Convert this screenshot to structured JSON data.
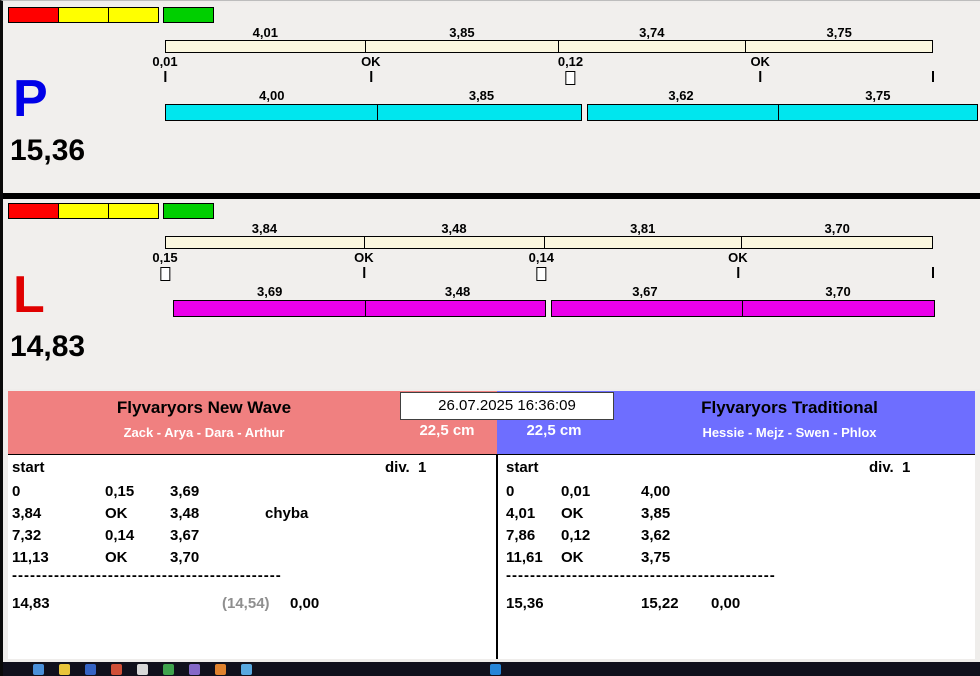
{
  "window": {
    "bg_color": "#f1efed",
    "divider_color": "#000000"
  },
  "lanes": [
    {
      "letter": "P",
      "letter_color": "#0000e8",
      "total": "15,36",
      "lights": [
        "#ff0000",
        "#ffff00",
        "#ffff00",
        "#00cf00"
      ],
      "split_bar": {
        "color": "#fbf7df",
        "segments": [
          {
            "label": "4,01",
            "value": 4.01
          },
          {
            "label": "3,85",
            "value": 3.85
          },
          {
            "label": "3,74",
            "value": 3.74
          },
          {
            "label": "3,75",
            "value": 3.75
          }
        ]
      },
      "markers": [
        {
          "label": "0,01",
          "symbol": "tick",
          "pos": 0
        },
        {
          "label": "OK",
          "symbol": "tick",
          "pos": 26.8
        },
        {
          "label": "0,12",
          "symbol": "box",
          "pos": 52.8
        },
        {
          "label": "OK",
          "symbol": "tick",
          "pos": 77.5
        }
      ],
      "time_bar": {
        "color": "#00e6ee",
        "segments": [
          {
            "label": "4,00",
            "value": 4.0
          },
          {
            "label": "3,85",
            "value": 3.85
          },
          {
            "label": "3,62",
            "value": 3.62
          },
          {
            "label": "3,75",
            "value": 3.75
          }
        ]
      }
    },
    {
      "letter": "L",
      "letter_color": "#e00000",
      "total": "14,83",
      "lights": [
        "#ff0000",
        "#ffff00",
        "#ffff00",
        "#00cf00"
      ],
      "split_bar": {
        "color": "#fbf7df",
        "segments": [
          {
            "label": "3,84",
            "value": 3.84
          },
          {
            "label": "3,48",
            "value": 3.48
          },
          {
            "label": "3,81",
            "value": 3.81
          },
          {
            "label": "3,70",
            "value": 3.7
          }
        ]
      },
      "markers": [
        {
          "label": "0,15",
          "symbol": "box",
          "pos": 0
        },
        {
          "label": "OK",
          "symbol": "tick",
          "pos": 25.9
        },
        {
          "label": "0,14",
          "symbol": "box",
          "pos": 49.0
        },
        {
          "label": "OK",
          "symbol": "tick",
          "pos": 74.6
        }
      ],
      "time_bar": {
        "color": "#ea00ea",
        "segments": [
          {
            "label": "3,69",
            "value": 3.69
          },
          {
            "label": "3,48",
            "value": 3.48
          },
          {
            "label": "3,67",
            "value": 3.67
          },
          {
            "label": "3,70",
            "value": 3.7
          }
        ]
      }
    }
  ],
  "scoreboard": {
    "datetime": "26.07.2025 16:36:09",
    "teams": [
      {
        "name": "Flyvaryors New Wave",
        "dogs": "Zack - Arya - Dara - Arthur",
        "jump_height": "22,5 cm",
        "header_color": "#f08080",
        "start_label": "start",
        "division_label": "div.  1",
        "rows": [
          {
            "cum": "0",
            "judge": "0,15",
            "split": "3,69",
            "note": ""
          },
          {
            "cum": "3,84",
            "judge": "OK",
            "split": "3,48",
            "note": "chyba"
          },
          {
            "cum": "7,32",
            "judge": "0,14",
            "split": "3,67",
            "note": ""
          },
          {
            "cum": "11,13",
            "judge": "OK",
            "split": "3,70",
            "note": ""
          }
        ],
        "separator": "---------------------------------------------",
        "total": "14,83",
        "net_total": "(14,54)",
        "net_total_color": "#8f8f8f",
        "penalty": "0,00"
      },
      {
        "name": "Flyvaryors Traditional",
        "dogs": "Hessie - Mejz - Swen - Phlox",
        "jump_height": "22,5 cm",
        "header_color": "#6e6eff",
        "start_label": "start",
        "division_label": "div.  1",
        "rows": [
          {
            "cum": "0",
            "judge": "0,01",
            "split": "4,00",
            "note": ""
          },
          {
            "cum": "4,01",
            "judge": "OK",
            "split": "3,85",
            "note": ""
          },
          {
            "cum": "7,86",
            "judge": "0,12",
            "split": "3,62",
            "note": ""
          },
          {
            "cum": "11,61",
            "judge": "OK",
            "split": "3,75",
            "note": ""
          }
        ],
        "separator": "---------------------------------------------",
        "total": "15,36",
        "net_total": "15,22",
        "net_total_color": "#000000",
        "penalty": "0,00"
      }
    ]
  },
  "taskbar": {
    "bg_color": "#10101c",
    "icons": [
      {
        "color": "#4a90d9"
      },
      {
        "color": "#e8c43a"
      },
      {
        "color": "#3563c4"
      },
      {
        "color": "#d05038"
      },
      {
        "color": "#d8d8d8"
      },
      {
        "color": "#3fa34d"
      },
      {
        "color": "#8468c8"
      },
      {
        "color": "#e0822e"
      },
      {
        "color": "#58a8e0"
      },
      {
        "color": "#2585d8"
      }
    ]
  }
}
